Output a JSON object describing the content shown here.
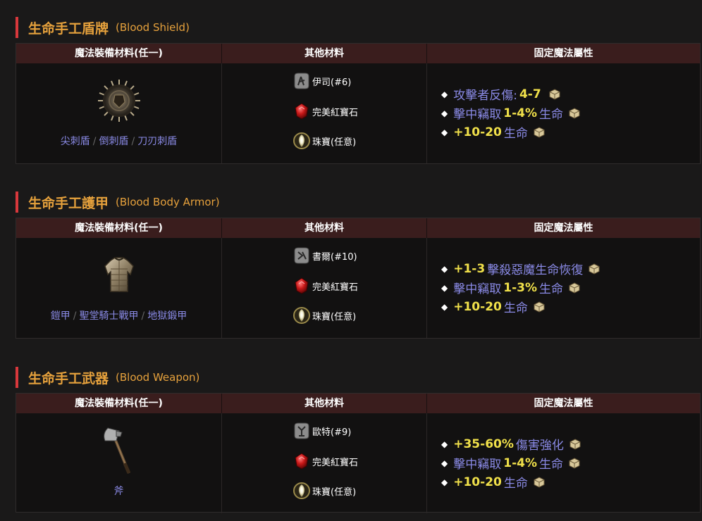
{
  "colors": {
    "accent_bar": "#d8383c",
    "title": "#e6a13c",
    "header_bg": "#3a1d1d",
    "magic_text": "#8a8ae6",
    "value_text": "#f0e04a"
  },
  "sections": [
    {
      "title_zh": "生命手工盾牌",
      "title_en": "(Blood Shield)",
      "headers": [
        "魔法裝備材料(任一)",
        "其他材料",
        "固定魔法屬性"
      ],
      "item_icon": "spiked-shield-icon",
      "bases": [
        "尖刺盾",
        "倒刺盾",
        "刀刃刺盾"
      ],
      "separator": "/",
      "materials": [
        {
          "icon": "rune-icon",
          "label": "伊司(#6)"
        },
        {
          "icon": "ruby-icon",
          "label": "完美紅寶石"
        },
        {
          "icon": "jewel-icon",
          "label": "珠寶(任意)"
        }
      ],
      "properties": [
        {
          "pre": "攻擊者反傷:",
          "num": "4-7",
          "post": ""
        },
        {
          "pre": "擊中竊取",
          "num": "1-4%",
          "post": "生命"
        },
        {
          "pre": "",
          "num": "+10-20",
          "post": "生命"
        }
      ]
    },
    {
      "title_zh": "生命手工護甲",
      "title_en": "(Blood Body Armor)",
      "headers": [
        "魔法裝備材料(任一)",
        "其他材料",
        "固定魔法屬性"
      ],
      "item_icon": "body-armor-icon",
      "bases": [
        "鎧甲",
        "聖堂騎士戰甲",
        "地獄鍛甲"
      ],
      "separator": "/",
      "materials": [
        {
          "icon": "rune-icon",
          "label": "書爾(#10)"
        },
        {
          "icon": "ruby-icon",
          "label": "完美紅寶石"
        },
        {
          "icon": "jewel-icon",
          "label": "珠寶(任意)"
        }
      ],
      "properties": [
        {
          "pre": "",
          "num": "+1-3",
          "post": "擊殺惡魔生命恢復"
        },
        {
          "pre": "擊中竊取",
          "num": "1-3%",
          "post": "生命"
        },
        {
          "pre": "",
          "num": "+10-20",
          "post": "生命"
        }
      ]
    },
    {
      "title_zh": "生命手工武器",
      "title_en": "(Blood Weapon)",
      "headers": [
        "魔法裝備材料(任一)",
        "其他材料",
        "固定魔法屬性"
      ],
      "item_icon": "axe-icon",
      "bases": [
        "斧"
      ],
      "separator": "/",
      "materials": [
        {
          "icon": "rune-icon",
          "label": "歐特(#9)"
        },
        {
          "icon": "ruby-icon",
          "label": "完美紅寶石"
        },
        {
          "icon": "jewel-icon",
          "label": "珠寶(任意)"
        }
      ],
      "properties": [
        {
          "pre": "",
          "num": "+35-60%",
          "post": "傷害強化"
        },
        {
          "pre": "擊中竊取",
          "num": "1-4%",
          "post": "生命"
        },
        {
          "pre": "",
          "num": "+10-20",
          "post": "生命"
        }
      ]
    }
  ]
}
